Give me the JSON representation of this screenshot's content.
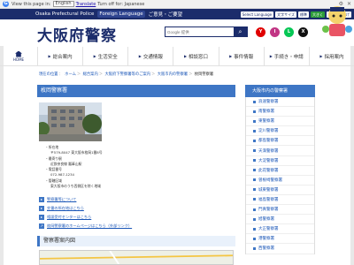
{
  "gtranslate": {
    "prefix": "View this page in:",
    "language": "English",
    "translate_label": "Translate",
    "turn_off": "Turn off for: Japanese"
  },
  "topbar": {
    "police_label": "Osaka Prefectural Police",
    "foreign_language": "Foreign Language",
    "opinion": "ご意見・ご要望",
    "select_language": "Select Language",
    "font_size": "文字サイズ",
    "std": "標準",
    "large": "大きく",
    "read": "音声読み上げ"
  },
  "header": {
    "site_title": "大阪府警察",
    "search_placeholder": "Google 提供",
    "search_icon": "search-icon",
    "sns": [
      "Y",
      "I",
      "L",
      "X"
    ]
  },
  "nav": {
    "home_label": "HOME",
    "items": [
      "総合案内",
      "生活安全",
      "交通情報",
      "相談窓口",
      "事件情報",
      "手続き・申請",
      "採用案内"
    ]
  },
  "breadcrumbs": [
    "現在の位置",
    "ホーム",
    "総合案内",
    "大阪府下警察署等のご案内",
    "大阪市内の警察署",
    "枚岡警察署"
  ],
  "main": {
    "page_title": "枚岡警察署",
    "info": [
      "所在地",
      "〒579-8047 東大阪市枚岡1番8号",
      "最寄り駅",
      "近鉄奈良線 瓢箪山駅",
      "電話番号",
      "072-987-1234",
      "管轄区域",
      "東大阪市のうち西側区を除く地域"
    ],
    "links": [
      "警察署等について",
      "交番の所在地はこちら",
      "相談受付センターはこちら",
      "枚岡警察署のホームページはこちら（外部リンク）"
    ],
    "map_heading": "警察署案内図"
  },
  "sidebar": {
    "heading": "大阪市内の警察署",
    "items": [
      "浪速警察署",
      "南警察署",
      "東警察署",
      "淀川警察署",
      "都島警察署",
      "天満警察署",
      "大淀警察署",
      "此花警察署",
      "曽根崎警察署",
      "城東警察署",
      "福島警察署",
      "門真警察署",
      "旭警察署",
      "大正警察署",
      "港警察署",
      "西警察署"
    ]
  }
}
